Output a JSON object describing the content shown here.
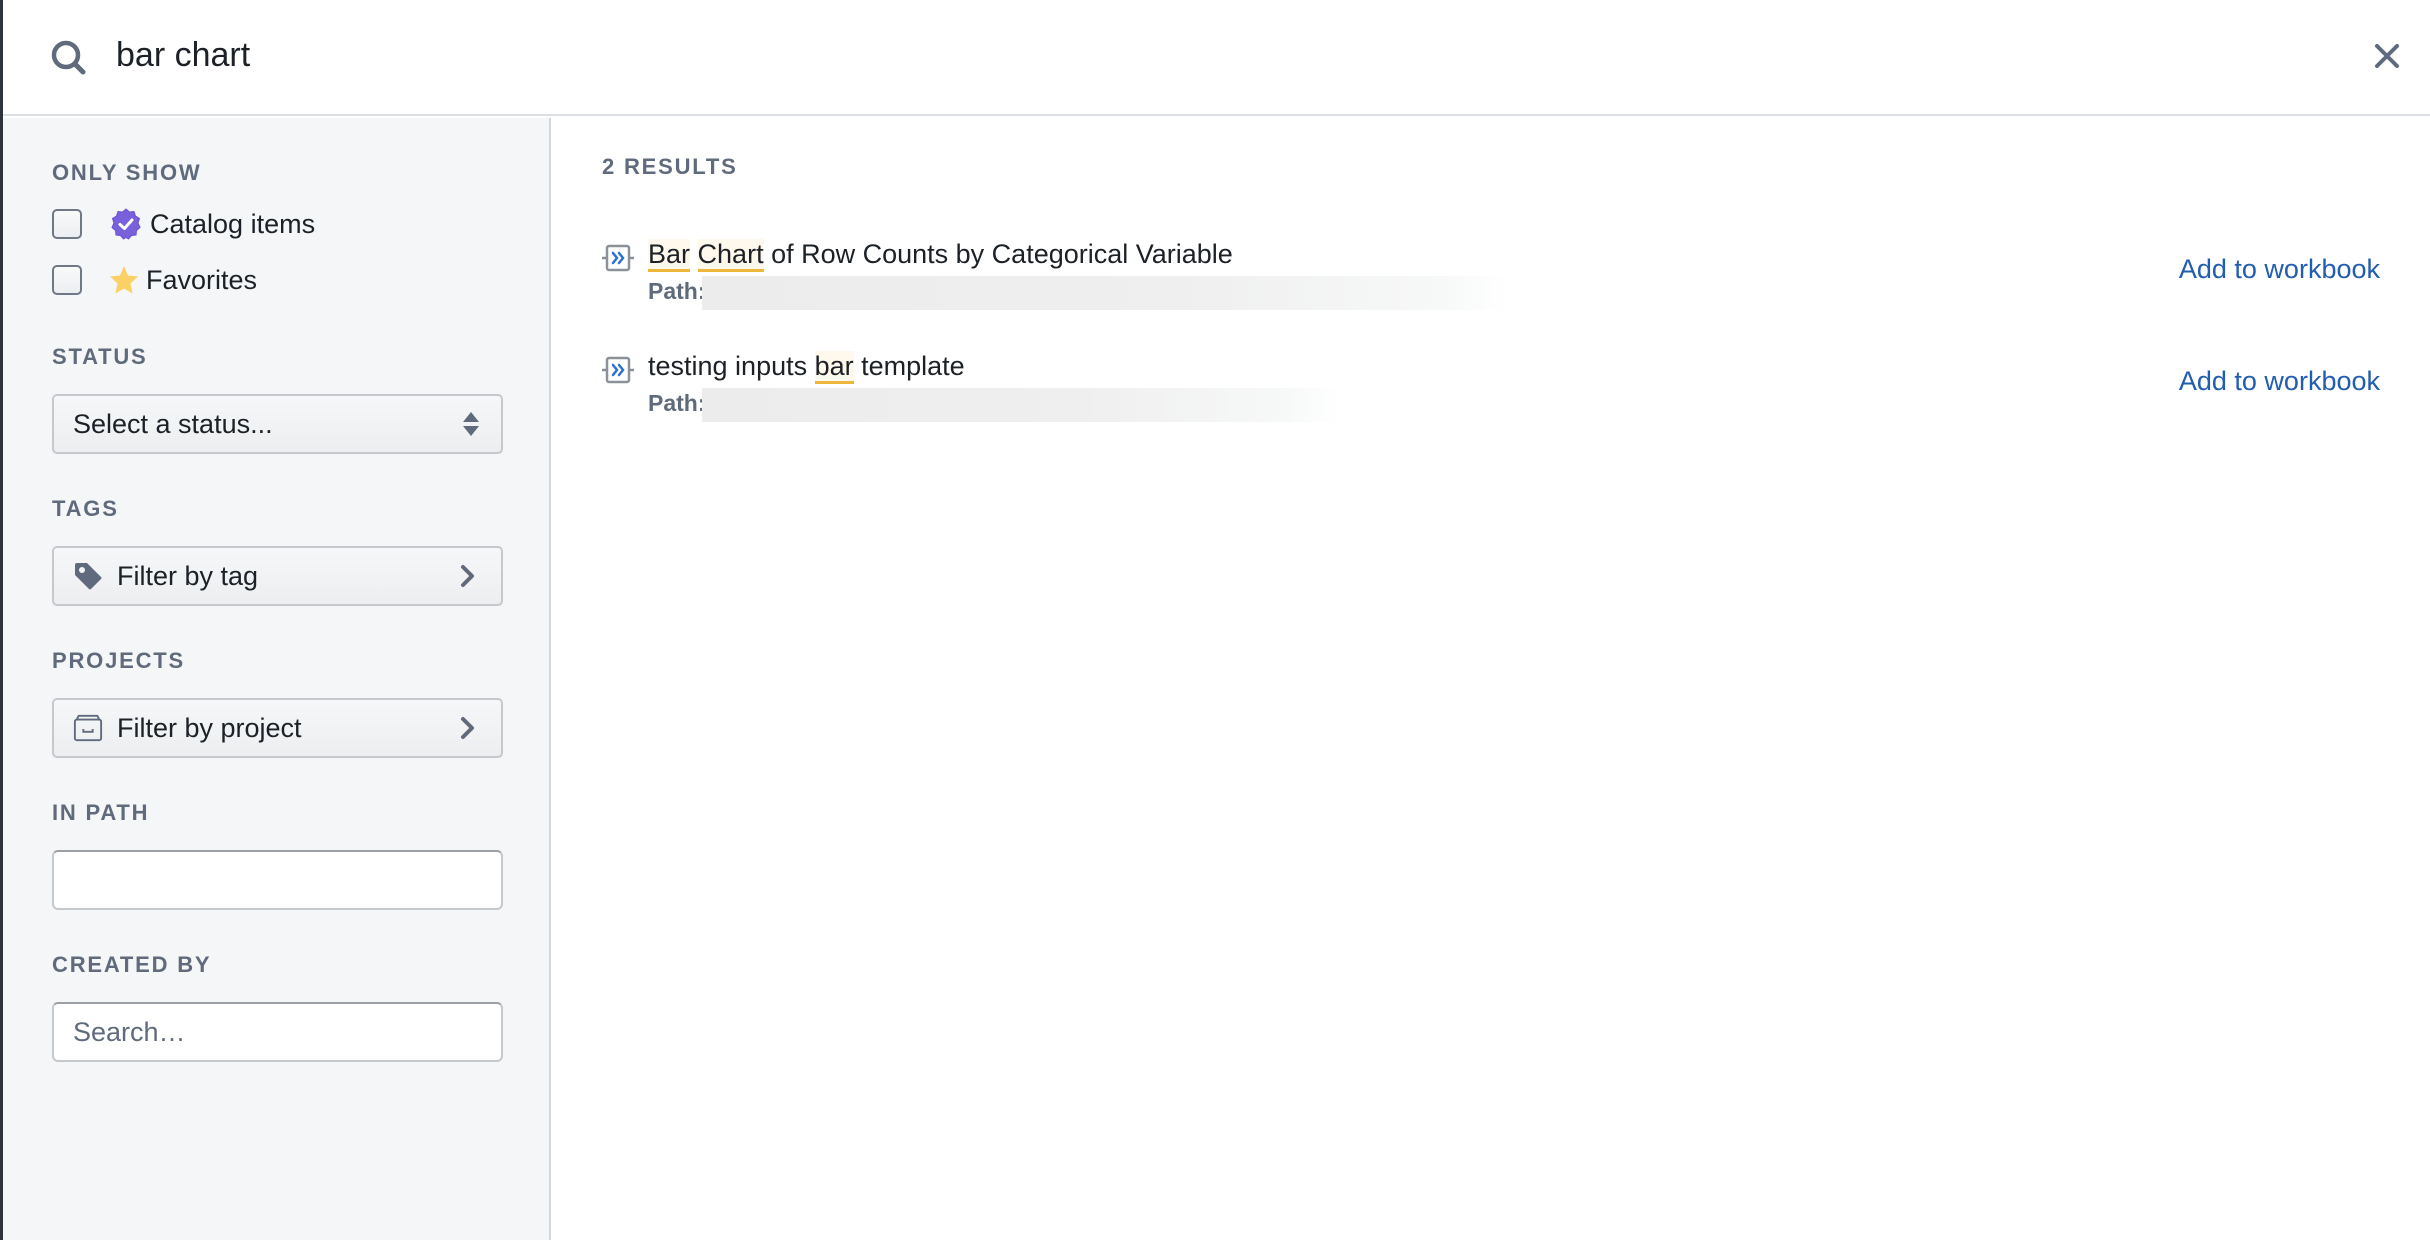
{
  "search": {
    "query": "bar chart",
    "icon": "search-icon",
    "close_icon": "close-icon"
  },
  "sidebar": {
    "only_show": {
      "label": "ONLY SHOW",
      "options": [
        {
          "label": "Catalog items",
          "icon": "verified-badge-icon",
          "checked": false,
          "icon_color": "#7961db"
        },
        {
          "label": "Favorites",
          "icon": "star-icon",
          "checked": false,
          "icon_color": "#fbd065"
        }
      ]
    },
    "status": {
      "label": "STATUS",
      "selected": "Select a status..."
    },
    "tags": {
      "label": "TAGS",
      "button_label": "Filter by tag",
      "icon": "tag-icon"
    },
    "projects": {
      "label": "PROJECTS",
      "button_label": "Filter by project",
      "icon": "project-box-icon"
    },
    "in_path": {
      "label": "IN PATH",
      "value": "",
      "placeholder": ""
    },
    "created_by": {
      "label": "CREATED BY",
      "value": "",
      "placeholder": "Search…"
    }
  },
  "results": {
    "count_label": "2 RESULTS",
    "items": [
      {
        "title_parts": [
          {
            "text": "Bar",
            "highlight": true
          },
          {
            "text": " ",
            "highlight": false
          },
          {
            "text": "Chart",
            "highlight": true
          },
          {
            "text": " of Row Counts by Categorical Variable",
            "highlight": false
          }
        ],
        "path_label": "Path:",
        "path_value": "",
        "action_label": "Add to workbook",
        "icon": "template-icon"
      },
      {
        "title_parts": [
          {
            "text": "testing inputs ",
            "highlight": false
          },
          {
            "text": "bar",
            "highlight": true
          },
          {
            "text": " template",
            "highlight": false
          }
        ],
        "path_label": "Path:",
        "path_value": "",
        "action_label": "Add to workbook",
        "icon": "template-icon"
      }
    ]
  },
  "colors": {
    "link": "#215db0",
    "highlight_underline": "#ecb73a",
    "muted_text": "#5f6b7c",
    "sidebar_bg": "#f5f6f8"
  }
}
